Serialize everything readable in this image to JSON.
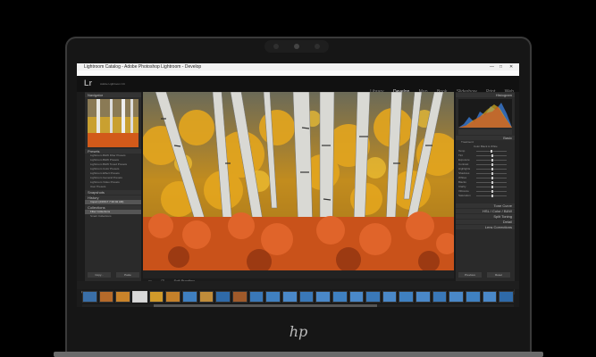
{
  "window": {
    "title": "Lightroom Catalog - Adobe Photoshop Lightroom - Develop",
    "controls": [
      "—",
      "□",
      "✕"
    ],
    "menu": [
      "File",
      "Edit",
      "Develop",
      "Photo",
      "Settings",
      "Tools",
      "View",
      "Window",
      "Help"
    ]
  },
  "app": {
    "logo": "Lr",
    "catalog": "Adobe Lightroom CC",
    "modules": [
      "Library",
      "Develop",
      "Map",
      "Book",
      "Slideshow",
      "Print",
      "Web"
    ],
    "active_module": "Develop"
  },
  "left_panel": {
    "navigator_label": "Navigator",
    "presets_label": "Presets",
    "preset_items": [
      "Lightroom B&W Filter Presets",
      "Lightroom B&W Presets",
      "Lightroom B&W Toned Presets",
      "Lightroom Color Presets",
      "Lightroom Effect Presets",
      "Lightroom General Presets",
      "Lightroom Video Presets",
      "User Presets"
    ],
    "snapshots_label": "Snapshots",
    "history_label": "History",
    "history_items": [
      "Import (2/15/17 7:30:02 AM)"
    ],
    "collections_label": "Collections",
    "collection_items": [
      "Filter Collections",
      "Smart Collections"
    ],
    "copy_button": "Copy...",
    "paste_button": "Paste"
  },
  "toolbar": {
    "soft_proofing": "Soft Proofing"
  },
  "filmstrip_bar": {
    "text": "Previous Import   1 photo / 1 selected / DSC_7712.jpg"
  },
  "right_panel": {
    "histogram_label": "Histogram",
    "basic_label": "Basic",
    "treatment_label": "Treatment:",
    "treatment_color": "Color",
    "treatment_bw": "Black & White",
    "sliders": [
      "Temp",
      "Tint",
      "Exposure",
      "Contrast",
      "Highlights",
      "Shadows",
      "Whites",
      "Blacks",
      "Clarity",
      "Vibrance",
      "Saturation"
    ],
    "sections": [
      "Tone Curve",
      "HSL / Color / B&W",
      "Split Toning",
      "Detail",
      "Lens Corrections"
    ],
    "previous_button": "Previous",
    "reset_button": "Reset"
  },
  "colors": {
    "panel": "#2a2a2a",
    "accent_orange": "#d86a1e",
    "aspen_yellow": "#e0a020"
  }
}
